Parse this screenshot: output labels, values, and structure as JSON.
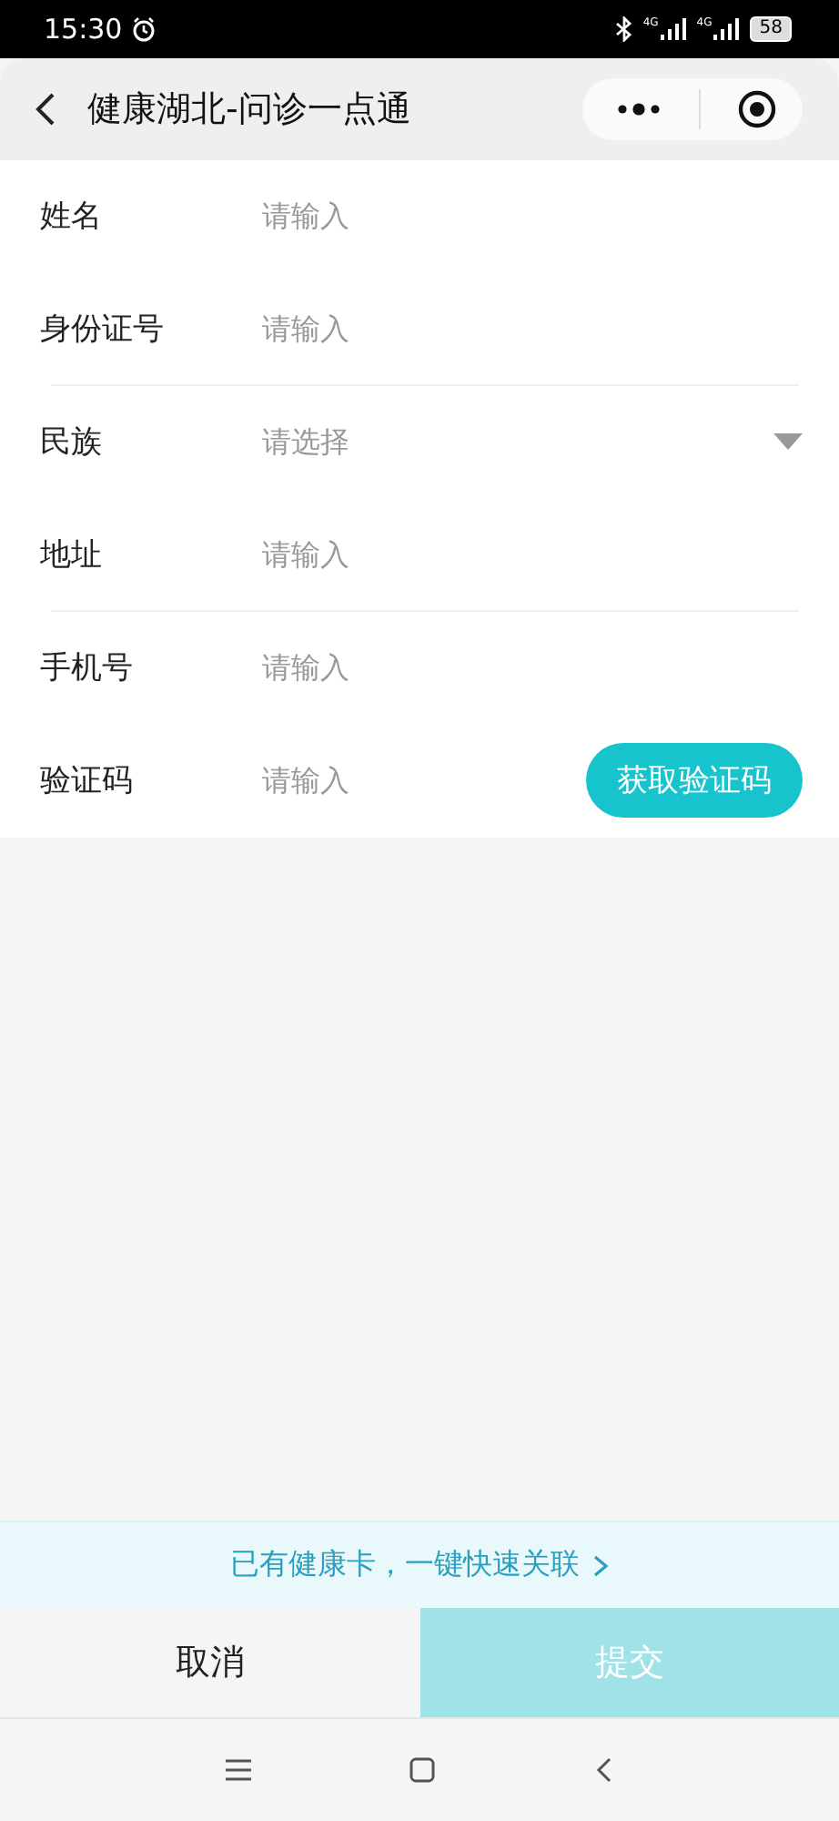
{
  "status_bar": {
    "time": "15:30",
    "network_labels": [
      "4G",
      "4G"
    ],
    "battery": "58"
  },
  "nav": {
    "title": "健康湖北-问诊一点通"
  },
  "form": {
    "fields": [
      {
        "kind": "input",
        "label": "姓名",
        "placeholder": "请输入",
        "divider": false
      },
      {
        "kind": "input",
        "label": "身份证号",
        "placeholder": "请输入",
        "divider": true
      },
      {
        "kind": "select",
        "label": "民族",
        "placeholder": "请选择",
        "divider": false
      },
      {
        "kind": "input",
        "label": "地址",
        "placeholder": "请输入",
        "divider": true
      },
      {
        "kind": "input",
        "label": "手机号",
        "placeholder": "请输入",
        "divider": false
      },
      {
        "kind": "code",
        "label": "验证码",
        "placeholder": "请输入",
        "button": "获取验证码",
        "divider": false
      }
    ]
  },
  "link_banner": {
    "text": "已有健康卡，一键快速关联"
  },
  "buttons": [
    {
      "label": "取消",
      "kind": "cancel",
      "disabled": false
    },
    {
      "label": "提交",
      "kind": "submit",
      "disabled": true
    }
  ]
}
